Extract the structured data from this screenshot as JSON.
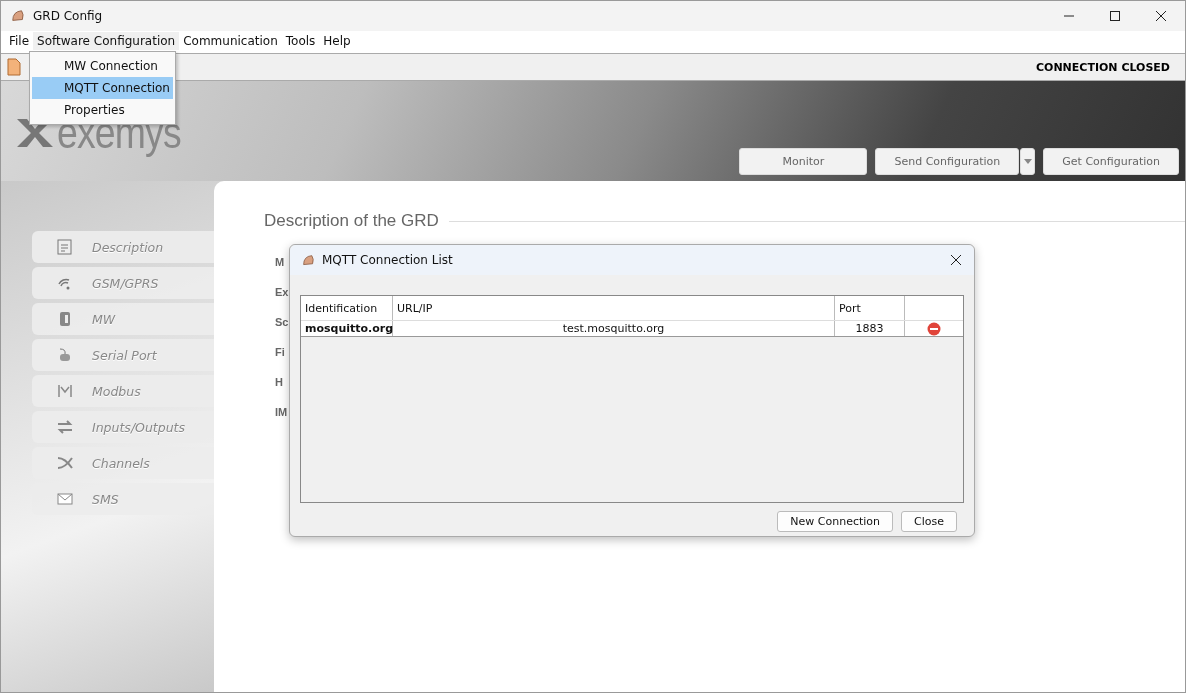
{
  "window": {
    "title": "GRD Config"
  },
  "menu_bar": [
    {
      "label": "File",
      "selected": false
    },
    {
      "label": "Software Configuration",
      "selected": true
    },
    {
      "label": "Communication",
      "selected": false
    },
    {
      "label": "Tools",
      "selected": false
    },
    {
      "label": "Help",
      "selected": false
    }
  ],
  "dropdown": [
    {
      "label": "MW Connection",
      "selected": false
    },
    {
      "label": "MQTT Connection",
      "selected": true
    },
    {
      "label": "Properties",
      "selected": false
    }
  ],
  "status": "CONNECTION CLOSED",
  "logo": "exemys",
  "actions": [
    {
      "label": "Monitor",
      "kind": "plain"
    },
    {
      "label": "Send Configuration",
      "kind": "split"
    },
    {
      "label": "Get Configuration",
      "kind": "plain"
    }
  ],
  "sidebar": {
    "items": [
      {
        "label": "Description"
      },
      {
        "label": "GSM/GPRS"
      },
      {
        "label": "MW"
      },
      {
        "label": "Serial Port"
      },
      {
        "label": "Modbus"
      },
      {
        "label": "Inputs/Outputs"
      },
      {
        "label": "Channels"
      },
      {
        "label": "SMS"
      }
    ]
  },
  "section_title": "Description of the GRD",
  "field_labels": [
    "M",
    "Ex",
    "Sc",
    "Fi",
    "H",
    "IM"
  ],
  "dialog": {
    "title": "MQTT Connection List",
    "columns": [
      "Identification",
      "URL/IP",
      "Port"
    ],
    "rows": [
      {
        "identification": "mosquitto.org",
        "url": "test.mosquitto.org",
        "port": "1883"
      }
    ],
    "buttons": [
      "New Connection",
      "Close"
    ]
  }
}
